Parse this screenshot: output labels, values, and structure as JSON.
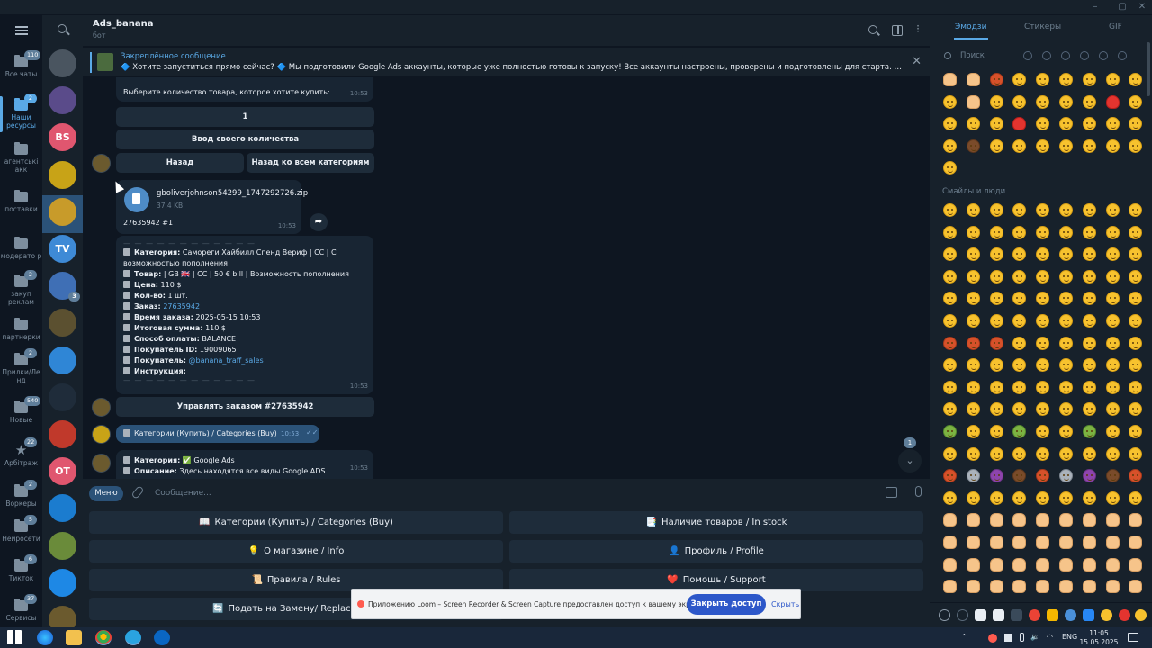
{
  "folders": [
    {
      "label": "Все чаты",
      "badge": "110",
      "selected": false
    },
    {
      "label": "Наши ресурсы",
      "badge": "2",
      "selected": true
    },
    {
      "label": "агентські акк",
      "badge": "",
      "selected": false
    },
    {
      "label": "поставки",
      "badge": "",
      "selected": false
    },
    {
      "label": "модерато р",
      "badge": "",
      "selected": false
    },
    {
      "label": "закуп реклам",
      "badge": "2",
      "selected": false
    },
    {
      "label": "партнерки",
      "badge": "",
      "selected": false
    },
    {
      "label": "Прилки/Ле нд",
      "badge": "2",
      "selected": false
    },
    {
      "label": "Новые",
      "badge": "540",
      "selected": false
    },
    {
      "label": "Арбітраж",
      "badge": "22",
      "selected": false
    },
    {
      "label": "Воркеры",
      "badge": "2",
      "selected": false
    },
    {
      "label": "Нейросети",
      "badge": "5",
      "selected": false
    },
    {
      "label": "Тикток",
      "badge": "6",
      "selected": false
    },
    {
      "label": "Сервисы",
      "badge": "37",
      "selected": false
    }
  ],
  "chat_avatars": [
    {
      "text": "",
      "color": "#4a5560",
      "badge": ""
    },
    {
      "text": "",
      "color": "#5a4b8a",
      "badge": ""
    },
    {
      "text": "BS",
      "color": "#e0566f",
      "badge": ""
    },
    {
      "text": "",
      "color": "#c8a317",
      "badge": ""
    },
    {
      "text": "",
      "color": "#c89b2a",
      "badge": ""
    },
    {
      "text": "TV",
      "color": "#3e8ad6",
      "badge": ""
    },
    {
      "text": "",
      "color": "#3f6fb5",
      "badge": "3"
    },
    {
      "text": "",
      "color": "#5b5030",
      "badge": ""
    },
    {
      "text": "",
      "color": "#2f86d6",
      "badge": ""
    },
    {
      "text": "",
      "color": "#1f2c3a",
      "badge": ""
    },
    {
      "text": "",
      "color": "#c0392b",
      "badge": ""
    },
    {
      "text": "OT",
      "color": "#e0566f",
      "badge": ""
    },
    {
      "text": "",
      "color": "#1b7ccf",
      "badge": ""
    },
    {
      "text": "",
      "color": "#6a8b3a",
      "badge": ""
    },
    {
      "text": "",
      "color": "#1e88e5",
      "badge": ""
    },
    {
      "text": "",
      "color": "#6b5a2e",
      "badge": ""
    }
  ],
  "chat": {
    "name": "Ads_banana",
    "status": "бот"
  },
  "pinned": {
    "title": "Закреплённое сообщение",
    "text": "🔷 Хотите запуститься прямо сейчас? 🔷 Мы подготовили Google Ads аккаунты, которые уже полностью готовы к запуску! Все аккаунты настроены, проверены и подготовлены для старта. Благодаря р..."
  },
  "messages": {
    "select_qty": {
      "text": "Выберите количество товара, которое хотите купить:",
      "time": "10:53"
    },
    "qty_buttons": {
      "one": "1",
      "custom": "Ввод своего количества",
      "back": "Назад",
      "back_all": "Назад ко всем категориям"
    },
    "file": {
      "name": "gboliverjohnson54299_1747292726.zip",
      "size": "37.4 KB",
      "caption": "27635942 #1",
      "time": "10:53"
    },
    "order": {
      "category_label": "Категория:",
      "category_value": "Самореги Хайбилл Спенд Вериф | CC | С",
      "category_value2": "возможностью пополнения",
      "product_label": "Товар:",
      "product_value": "| GB 🇬🇧 | CC | 50 € bill | Возможность пополнения",
      "price_label": "Цена:",
      "price_value": "110 $",
      "qty_label": "Кол-во:",
      "qty_value": "1 шт.",
      "order_label": "Заказ:",
      "order_value": "27635942",
      "time_label": "Время заказа:",
      "time_value": "2025-05-15 10:53",
      "total_label": "Итоговая сумма:",
      "total_value": "110 $",
      "pay_label": "Способ оплаты:",
      "pay_value": "BALANCE",
      "buyer_id_label": "Покупатель ID:",
      "buyer_id_value": "19009065",
      "buyer_label": "Покупатель:",
      "buyer_value": "@banana_traff_sales",
      "instr_label": "Инструкция:",
      "time": "10:53"
    },
    "manage_button": "Управлять заказом #27635942",
    "outgoing": {
      "text": "Категории (Купить) / Categories (Buy)",
      "time": "10:53"
    },
    "last": {
      "category_label": "Категория:",
      "category_value": "✅ Google Ads",
      "desc_label": "Описание:",
      "desc_value": "Здесь находятся все виды Google ADS",
      "time": "10:53"
    }
  },
  "scroll_badge": "1",
  "composer": {
    "menu": "Меню",
    "placeholder": "Сообщение..."
  },
  "keyboard": [
    {
      "icon": "📖",
      "label": "Категории (Купить) / Categories (Buy)"
    },
    {
      "icon": "📑",
      "label": "Наличие товаров / In stock"
    },
    {
      "icon": "💡",
      "label": "О магазине / Info"
    },
    {
      "icon": "👤",
      "label": "Профиль / Profile"
    },
    {
      "icon": "📜",
      "label": "Правила / Rules"
    },
    {
      "icon": "❤️",
      "label": "Помощь / Support"
    },
    {
      "icon": "🔄",
      "label": "Подать на Замену/ Replacement"
    },
    {
      "icon": "",
      "label": ""
    }
  ],
  "emoji_panel": {
    "tabs": [
      "Эмодзи",
      "Стикеры",
      "GIF"
    ],
    "search_placeholder": "Поиск",
    "section": "Смайлы и люди"
  },
  "toast": {
    "text": "Приложению Loom – Screen Recorder & Screen Capture предоставлен доступ к вашему экрану.",
    "button": "Закрыть доступ",
    "link": "Скрыть"
  },
  "taskbar": {
    "lang": "ENG",
    "time": "11:05",
    "date": "15.05.2025"
  }
}
